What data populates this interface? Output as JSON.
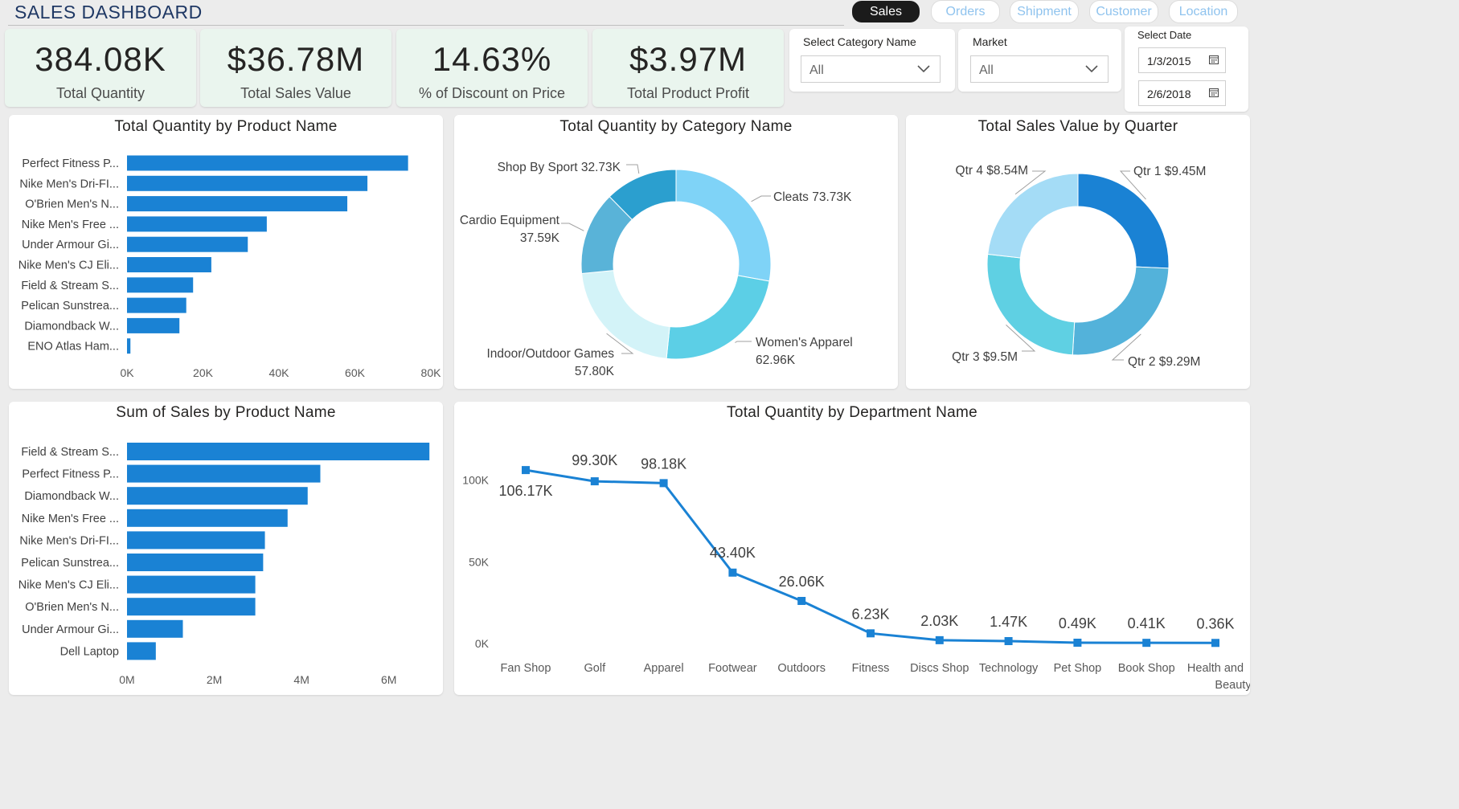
{
  "header": {
    "title": "SALES DASHBOARD"
  },
  "nav": {
    "tabs": [
      {
        "label": "Sales",
        "active": true
      },
      {
        "label": "Orders",
        "active": false
      },
      {
        "label": "Shipment",
        "active": false
      },
      {
        "label": "Customer",
        "active": false
      },
      {
        "label": "Location",
        "active": false
      }
    ]
  },
  "kpis": [
    {
      "value": "384.08K",
      "label": "Total Quantity"
    },
    {
      "value": "$36.78M",
      "label": "Total Sales Value"
    },
    {
      "value": "14.63%",
      "label": "% of Discount on Price"
    },
    {
      "value": "$3.97M",
      "label": "Total Product Profit"
    }
  ],
  "filters": {
    "category": {
      "label": "Select Category Name",
      "value": "All"
    },
    "market": {
      "label": "Market",
      "value": "All"
    },
    "date": {
      "label": "Select Date",
      "start": "1/3/2015",
      "end": "2/6/2018"
    }
  },
  "colors": {
    "bar": "#1a82d4",
    "line": "#1a82d4",
    "category_donut": [
      "#7fd3f7",
      "#5ccfe6",
      "#d3f3f8",
      "#59b3d8",
      "#2b9fcf"
    ],
    "quarter_donut": [
      "#1a82d4",
      "#53b2da",
      "#5fd0e3",
      "#a4dcf6"
    ]
  },
  "chart_data": [
    {
      "type": "bar",
      "orientation": "horizontal",
      "title": "Total Quantity by Product Name",
      "categories": [
        "Perfect Fitness P...",
        "Nike Men's Dri-FI...",
        "O'Brien Men's N...",
        "Nike Men's Free ...",
        "Under Armour Gi...",
        "Nike Men's CJ Eli...",
        "Field & Stream S...",
        "Pelican Sunstrea...",
        "Diamondback W...",
        "ENO Atlas Ham..."
      ],
      "values": [
        74000,
        63300,
        58000,
        36800,
        31800,
        22200,
        17400,
        15600,
        13800,
        900
      ],
      "xlim": [
        0,
        80000
      ],
      "xticks": [
        "0K",
        "20K",
        "40K",
        "60K",
        "80K"
      ],
      "xtick_values": [
        0,
        20000,
        40000,
        60000,
        80000
      ]
    },
    {
      "type": "pie",
      "donut": true,
      "title": "Total Quantity by Category Name",
      "labels": [
        "Cleats",
        "Women's Apparel",
        "Indoor/Outdoor Games",
        "Cardio Equipment",
        "Shop By Sport"
      ],
      "values": [
        73.73,
        62.96,
        57.8,
        37.59,
        32.73
      ],
      "value_labels": [
        "73.73K",
        "62.96K",
        "57.80K",
        "37.59K",
        "32.73K"
      ]
    },
    {
      "type": "pie",
      "donut": true,
      "title": "Total Sales Value by Quarter",
      "labels": [
        "Qtr 1",
        "Qtr 2",
        "Qtr 3",
        "Qtr 4"
      ],
      "values": [
        9.45,
        9.29,
        9.5,
        8.54
      ],
      "value_labels": [
        "$9.45M",
        "$9.29M",
        "$9.5M",
        "$8.54M"
      ]
    },
    {
      "type": "bar",
      "orientation": "horizontal",
      "title": "Sum of Sales by Product Name",
      "categories": [
        "Field & Stream S...",
        "Perfect Fitness P...",
        "Diamondback W...",
        "Nike Men's Free ...",
        "Nike Men's Dri-FI...",
        "Pelican Sunstrea...",
        "Nike Men's CJ Eli...",
        "O'Brien Men's N...",
        "Under Armour Gi...",
        "Dell Laptop"
      ],
      "values": [
        6930000,
        4430000,
        4140000,
        3680000,
        3160000,
        3120000,
        2940000,
        2940000,
        1280000,
        660000
      ],
      "xlim": [
        0,
        7000000
      ],
      "xticks": [
        "0M",
        "2M",
        "4M",
        "6M"
      ],
      "xtick_values": [
        0,
        2000000,
        4000000,
        6000000
      ]
    },
    {
      "type": "line",
      "title": "Total Quantity by Department Name",
      "categories": [
        "Fan Shop",
        "Golf",
        "Apparel",
        "Footwear",
        "Outdoors",
        "Fitness",
        "Discs Shop",
        "Technology",
        "Pet Shop",
        "Book Shop",
        "Health and Beauty"
      ],
      "values": [
        106170,
        99300,
        98180,
        43400,
        26060,
        6230,
        2030,
        1470,
        490,
        410,
        360
      ],
      "value_labels": [
        "106.17K",
        "99.30K",
        "98.18K",
        "43.40K",
        "26.06K",
        "6.23K",
        "2.03K",
        "1.47K",
        "0.49K",
        "0.41K",
        "0.36K"
      ],
      "ylim": [
        0,
        120000
      ],
      "yticks": [
        "0K",
        "50K",
        "100K"
      ],
      "ytick_values": [
        0,
        50000,
        100000
      ]
    }
  ]
}
